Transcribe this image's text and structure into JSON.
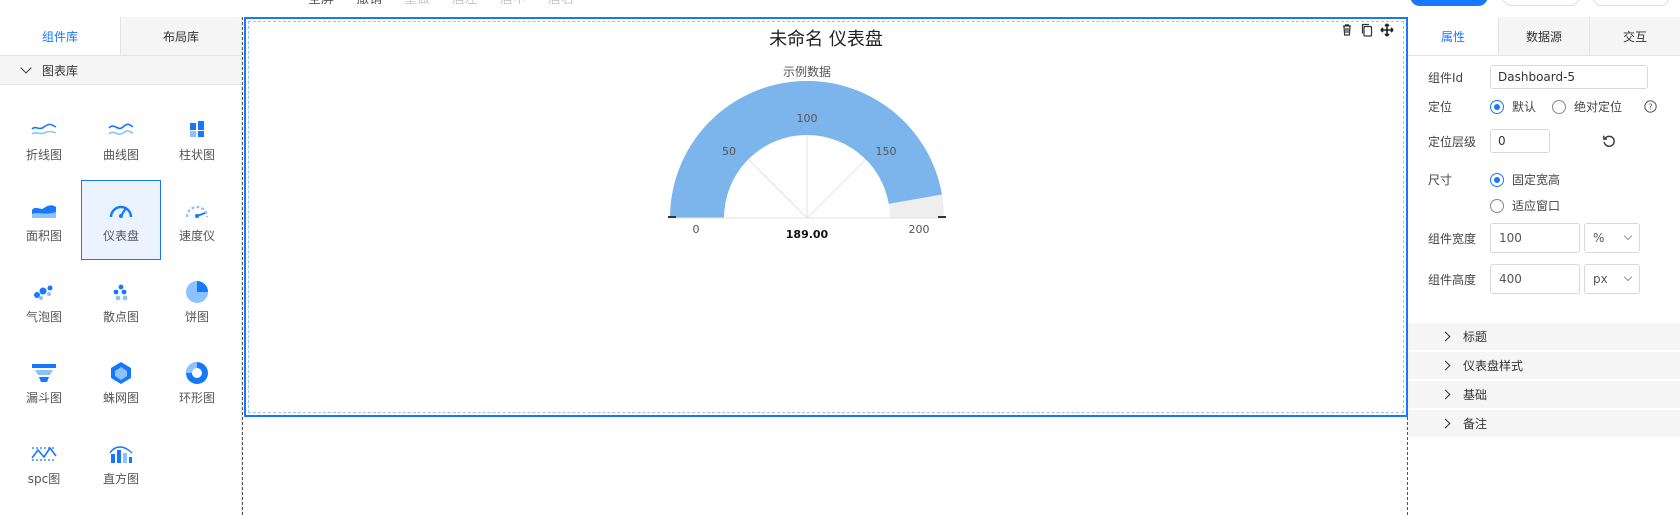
{
  "toolbar": {
    "items": [
      "全屏",
      "撤销",
      "重做",
      "居左",
      "居中",
      "居右"
    ],
    "disabled": [
      false,
      false,
      true,
      true,
      true,
      true
    ]
  },
  "left_panel": {
    "tabs": [
      "组件库",
      "布局库"
    ],
    "active_tab": 0,
    "section": "图表库",
    "components": [
      {
        "label": "折线图",
        "icon": "line-chart-icon"
      },
      {
        "label": "曲线图",
        "icon": "curve-chart-icon"
      },
      {
        "label": "柱状图",
        "icon": "bar-chart-icon"
      },
      {
        "label": "面积图",
        "icon": "area-chart-icon"
      },
      {
        "label": "仪表盘",
        "icon": "gauge-icon",
        "selected": true
      },
      {
        "label": "速度仪",
        "icon": "speedometer-icon"
      },
      {
        "label": "气泡图",
        "icon": "bubble-chart-icon"
      },
      {
        "label": "散点图",
        "icon": "scatter-chart-icon"
      },
      {
        "label": "饼图",
        "icon": "pie-chart-icon"
      },
      {
        "label": "漏斗图",
        "icon": "funnel-chart-icon"
      },
      {
        "label": "蛛网图",
        "icon": "radar-chart-icon"
      },
      {
        "label": "环形图",
        "icon": "donut-chart-icon"
      },
      {
        "label": "spc图",
        "icon": "spc-chart-icon"
      },
      {
        "label": "直方图",
        "icon": "histogram-icon"
      }
    ]
  },
  "widget": {
    "title": "未命名 仪表盘",
    "tools": [
      "delete-icon",
      "copy-icon",
      "move-icon"
    ]
  },
  "chart_data": {
    "type": "gauge",
    "series_name": "示例数据",
    "min": 0,
    "max": 200,
    "value": 189.0,
    "value_label": "189.00",
    "tick_labels": [
      "0",
      "50",
      "100",
      "150",
      "200"
    ],
    "colors": {
      "fill": "#7cb5ec",
      "track": "#eeeeee"
    }
  },
  "right_panel": {
    "tabs": [
      "属性",
      "数据源",
      "交互"
    ],
    "active_tab": 0,
    "component_id_label": "组件Id",
    "component_id": "Dashboard-5",
    "position_label": "定位",
    "position_options": [
      "默认",
      "绝对定位"
    ],
    "position_selected": 0,
    "zindex_label": "定位层级",
    "zindex": "0",
    "size_label": "尺寸",
    "size_options": [
      "固定宽高",
      "适应窗口"
    ],
    "size_selected": 0,
    "width_label": "组件宽度",
    "width_value": "100",
    "width_unit": "%",
    "height_label": "组件高度",
    "height_value": "400",
    "height_unit": "px",
    "sections": [
      "标题",
      "仪表盘样式",
      "基础",
      "备注"
    ]
  },
  "accent": "#1677ff"
}
